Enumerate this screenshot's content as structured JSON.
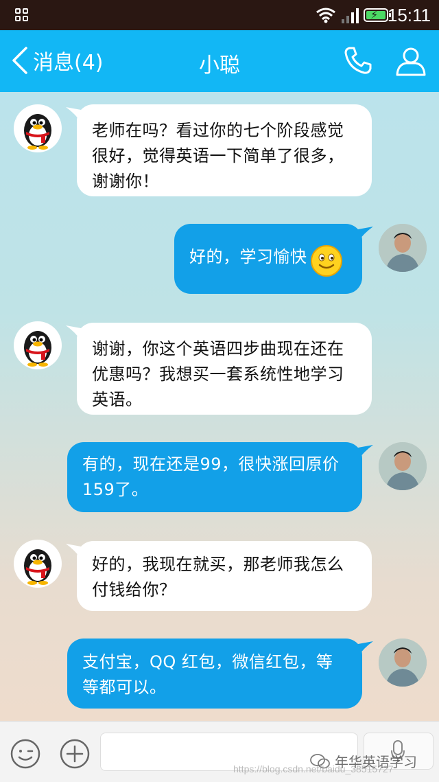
{
  "status_bar": {
    "time": "15:11"
  },
  "header": {
    "back_label": "消息(4)",
    "title": "小聪"
  },
  "messages": [
    {
      "side": "left",
      "text": "老师在吗？看过你的七个阶段感觉很好，觉得英语一下简单了很多，谢谢你！"
    },
    {
      "side": "right",
      "text": "好的，学习愉快",
      "emoji": "smiley-emoji"
    },
    {
      "side": "left",
      "text": "谢谢，你这个英语四步曲现在还在优惠吗？我想买一套系统性地学习英语。"
    },
    {
      "side": "right",
      "text": "有的，现在还是99，很快涨回原价159了。"
    },
    {
      "side": "left",
      "text": "好的，我现在就买，那老师我怎么付钱给你？"
    },
    {
      "side": "right",
      "text": "支付宝，QQ 红包，微信红包，等等都可以。"
    }
  ],
  "input_bar": {
    "value": "",
    "placeholder": ""
  },
  "watermark": {
    "label": "年华英语学习",
    "url": "https://blog.csdn.net/baidu_38515727"
  },
  "colors": {
    "status_bar": "#2a1712",
    "header": "#12b7f5",
    "outgoing_bubble": "#12a0e8",
    "incoming_bubble": "#ffffff"
  }
}
